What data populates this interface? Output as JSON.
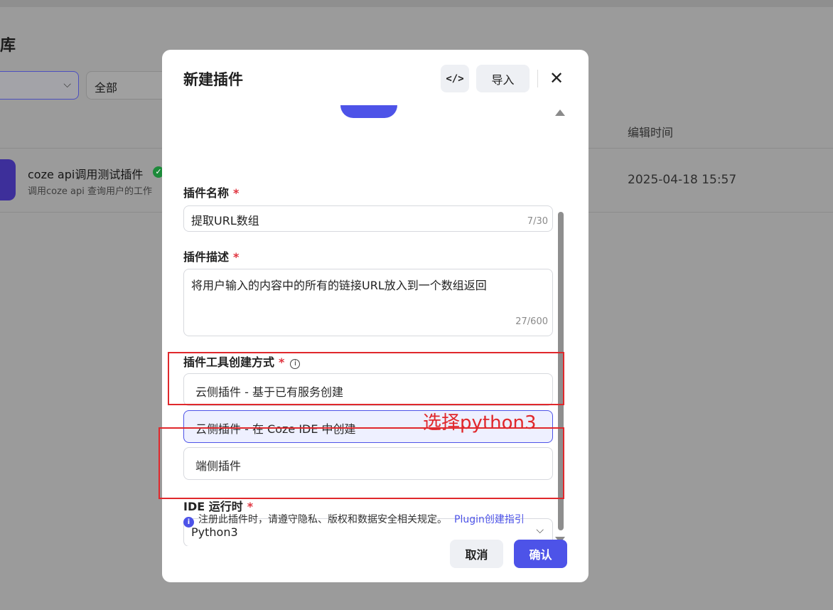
{
  "background": {
    "page_title": "库",
    "filter_select_1": "",
    "filter_select_2": "全部",
    "column_edit_time": "编辑时间",
    "plugin": {
      "name": "coze api调用测试插件",
      "description": "调用coze api 查询用户的工作",
      "edit_time": "2025-04-18 15:57"
    }
  },
  "modal": {
    "title": "新建插件",
    "code_button": "</>",
    "import_button": "导入",
    "close_icon": "✕",
    "fields": {
      "name": {
        "label": "插件名称",
        "required": "*",
        "value": "提取URL数组",
        "count": "7/30"
      },
      "description": {
        "label": "插件描述",
        "required": "*",
        "value": "将用户输入的内容中的所有的链接URL放入到一个数组返回",
        "count": "27/600"
      },
      "creation_method": {
        "label": "插件工具创建方式",
        "required": "*",
        "info_icon": "i",
        "options": [
          {
            "label": "云侧插件 - 基于已有服务创建",
            "selected": false
          },
          {
            "label": "云侧插件 - 在 Coze IDE 中创建",
            "selected": true
          },
          {
            "label": "端侧插件",
            "selected": false
          }
        ]
      },
      "ide_runtime": {
        "label": "IDE 运行时",
        "required": "*",
        "value": "Python3"
      }
    },
    "notice": {
      "icon": "i",
      "text": "注册此插件时，请遵守隐私、版权和数据安全相关规定。",
      "link": "Plugin创建指引"
    },
    "cancel_button": "取消",
    "confirm_button": "确认"
  },
  "annotations": {
    "text": "选择python3",
    "color": "#e0282c"
  },
  "colors": {
    "accent": "#4d53e8",
    "required": "#e0343f"
  }
}
